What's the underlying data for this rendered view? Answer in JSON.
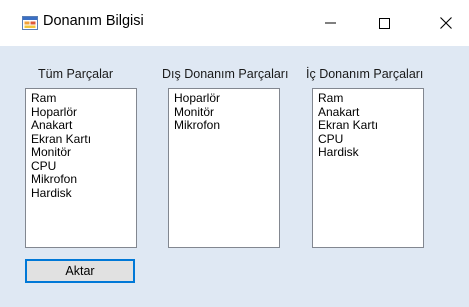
{
  "window": {
    "title": "Donanım Bilgisi",
    "controls": {
      "minimize": "minimize-icon",
      "maximize": "maximize-icon",
      "close": "close-icon"
    }
  },
  "lists": {
    "all": {
      "label": "Tüm Parçalar",
      "items": [
        "Ram",
        "Hoparlör",
        "Anakart",
        "Ekran Kartı",
        "Monitör",
        "CPU",
        "Mikrofon",
        "Hardisk"
      ]
    },
    "external": {
      "label": "Dış Donanım Parçaları",
      "items": [
        "Hoparlör",
        "Monitör",
        "Mikrofon"
      ]
    },
    "internal": {
      "label": "İç Donanım Parçaları",
      "items": [
        "Ram",
        "Anakart",
        "Ekran Kartı",
        "CPU",
        "Hardisk"
      ]
    }
  },
  "buttons": {
    "transfer": "Aktar"
  },
  "colors": {
    "form_bg": "#dfe8f3",
    "focus_border": "#0078d7"
  }
}
